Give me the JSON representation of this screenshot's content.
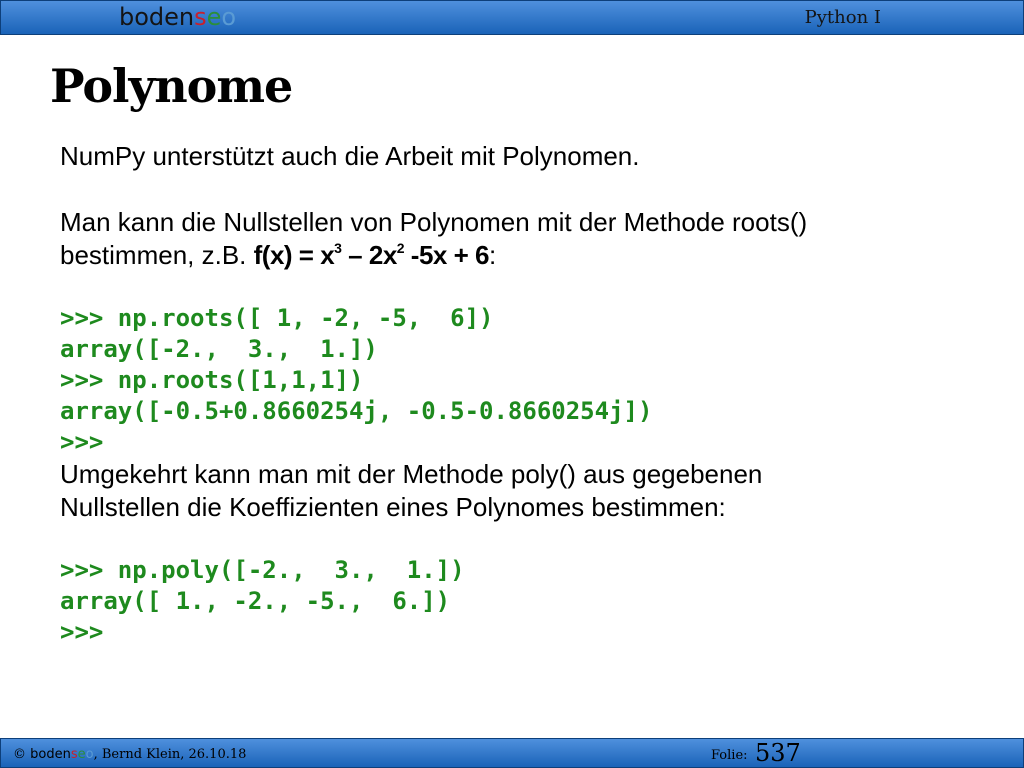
{
  "header": {
    "logo": {
      "part1": "boden",
      "s": "s",
      "e": "e",
      "o": "o"
    },
    "course": "Python I"
  },
  "slide": {
    "title": "Polynome",
    "intro": "NumPy unterstützt auch die Arbeit mit Polynomen.",
    "roots_text_1": "Man kann die Nullstellen von Polynomen mit der Methode roots()",
    "roots_text_2": "bestimmen, z.B. ",
    "formula": {
      "lhs": "f(x) = x",
      "exp1": "3",
      "mid": " – 2x",
      "exp2": "2",
      "rhs": " -5x + 6"
    },
    "formula_colon": ":",
    "code_block_1": [
      ">>> np.roots([ 1, -2, -5,  6])",
      "array([-2.,  3.,  1.])",
      ">>> np.roots([1,1,1])",
      "array([-0.5+0.8660254j, -0.5-0.8660254j])",
      ">>>"
    ],
    "poly_text_1": "Umgekehrt kann man mit der Methode poly() aus gegebenen",
    "poly_text_2": "Nullstellen die Koeffizienten eines Polynomes bestimmen:",
    "code_block_2": [
      ">>> np.poly([-2.,  3.,  1.])",
      "array([ 1., -2., -5.,  6.])",
      ">>>"
    ]
  },
  "footer": {
    "copyright_symbol": "©",
    "brand": {
      "part1": "boden",
      "s": "s",
      "e": "e",
      "o": "o"
    },
    "author_date": ", Bernd Klein, 26.10.18",
    "folie_label": "Folie:",
    "folie_number": "537"
  },
  "colors": {
    "bar_top": "#4f90dd",
    "bar_bottom": "#1a63b8",
    "code_green": "#1e8a1e",
    "logo_s": "#c8202c",
    "logo_e": "#2b8e3a",
    "logo_o": "#5a9bd4"
  }
}
